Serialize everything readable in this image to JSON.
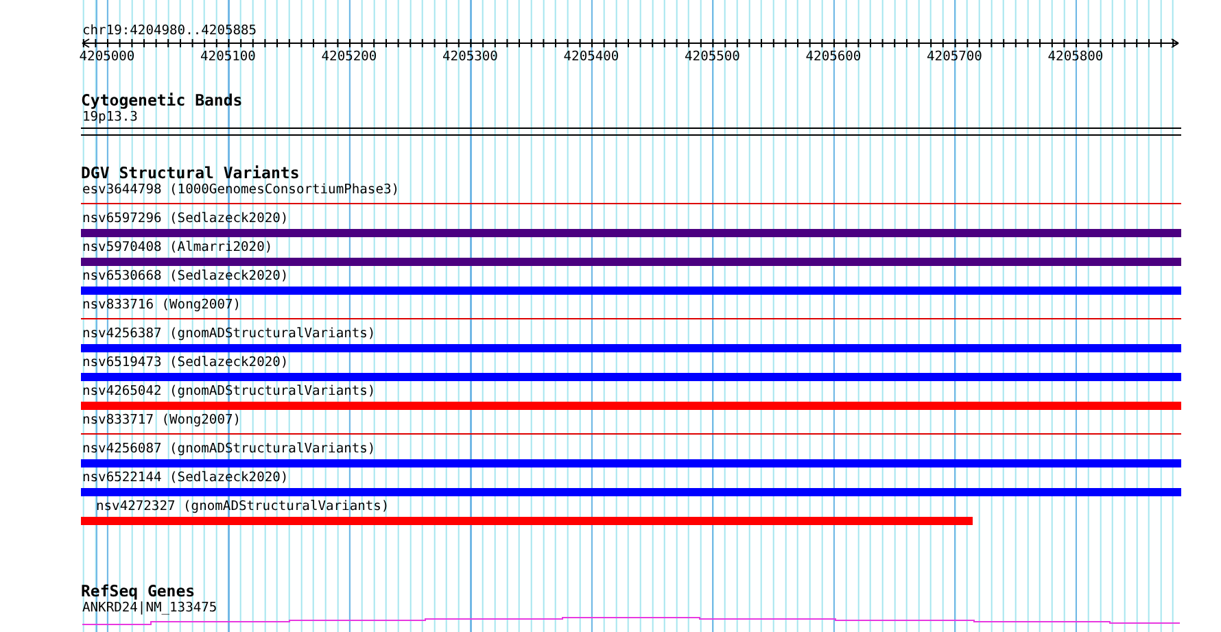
{
  "ruler": {
    "position": "chr19:4204980..4205885",
    "ticks": [
      "4205000",
      "4205100",
      "4205200",
      "4205300",
      "4205400",
      "4205500",
      "4205600",
      "4205700",
      "4205800"
    ]
  },
  "tracks": [
    {
      "kind": "bands",
      "title": "Cytogenetic Bands",
      "label": "19p13.3"
    },
    {
      "kind": "variants",
      "title": "DGV Structural Variants",
      "items": [
        {
          "label": "esv3644798 (1000GenomesConsortiumPhase3)",
          "kind": "thin",
          "color": "#dd0000",
          "level": 1
        },
        {
          "label": "nsv6597296 (Sedlazeck2020)",
          "kind": "thick",
          "color": "#4b0080",
          "level": 1
        },
        {
          "label": "nsv5970408 (Almarri2020)",
          "kind": "thick",
          "color": "#4b0080",
          "level": 1
        },
        {
          "label": "nsv6530668 (Sedlazeck2020)",
          "kind": "thick",
          "color": "#0000ff",
          "level": 1
        },
        {
          "label": "nsv833716 (Wong2007)",
          "kind": "thin",
          "color": "#dd0000",
          "level": 1
        },
        {
          "label": "nsv4256387 (gnomADStructuralVariants)",
          "kind": "thick",
          "color": "#0000ff",
          "level": 1
        },
        {
          "label": "nsv6519473 (Sedlazeck2020)",
          "kind": "thick",
          "color": "#0000ff",
          "level": 1
        },
        {
          "label": "nsv4265042 (gnomADStructuralVariants)",
          "kind": "thick",
          "color": "#ff0000",
          "level": 1
        },
        {
          "label": "nsv833717 (Wong2007)",
          "kind": "thin",
          "color": "#dd0000",
          "level": 1
        },
        {
          "label": "nsv4256087 (gnomADStructuralVariants)",
          "kind": "thick",
          "color": "#0000ff",
          "level": 1
        },
        {
          "label": "nsv6522144 (Sedlazeck2020)",
          "kind": "thick",
          "color": "#0000ff",
          "level": 1
        },
        {
          "label": "nsv4272327 (gnomADStructuralVariants)",
          "kind": "thick",
          "color": "#ff0000",
          "level": 0.81
        }
      ]
    },
    {
      "kind": "genes",
      "title": "RefSeq Genes",
      "label": "ANKRD24|NM_133475"
    }
  ]
}
